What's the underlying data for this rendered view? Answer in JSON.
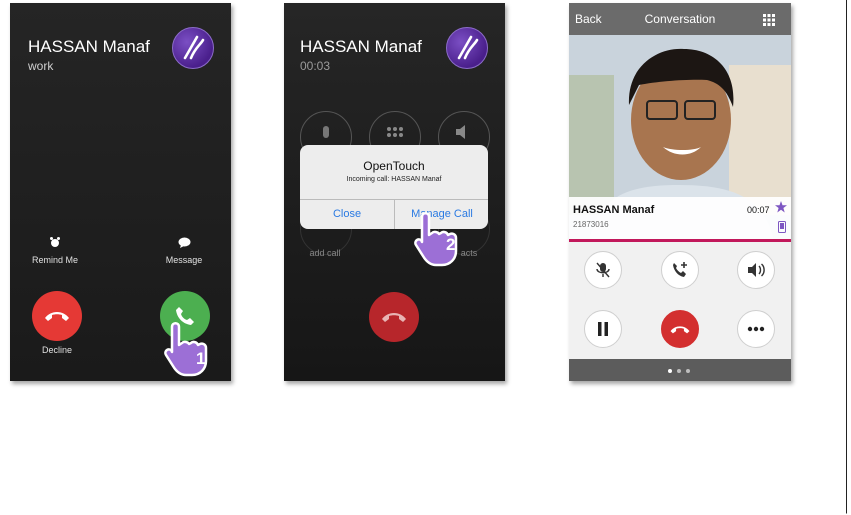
{
  "screen1": {
    "caller_name": "HASSAN Manaf",
    "caller_type": "work",
    "remind_label": "Remind Me",
    "message_label": "Message",
    "decline_label": "Decline",
    "step": "1"
  },
  "screen2": {
    "caller_name": "HASSAN Manaf",
    "timer": "00:03",
    "add_call_label": "add call",
    "contacts_label_fragment": "acts",
    "dialog": {
      "title": "OpenTouch",
      "message": "Incoming call: HASSAN Manaf",
      "close_label": "Close",
      "manage_label": "Manage Call"
    },
    "step": "2"
  },
  "screen3": {
    "back_label": "Back",
    "title": "Conversation",
    "caller_name": "HASSAN Manaf",
    "caller_number": "21873016",
    "timer": "00:07"
  },
  "colors": {
    "decline_red": "#e53935",
    "accept_green": "#4caf50",
    "hangup_red": "#c62828",
    "accent_purple": "#7e57c2",
    "pink_line": "#c2185b",
    "link_blue": "#2a7ae2"
  }
}
